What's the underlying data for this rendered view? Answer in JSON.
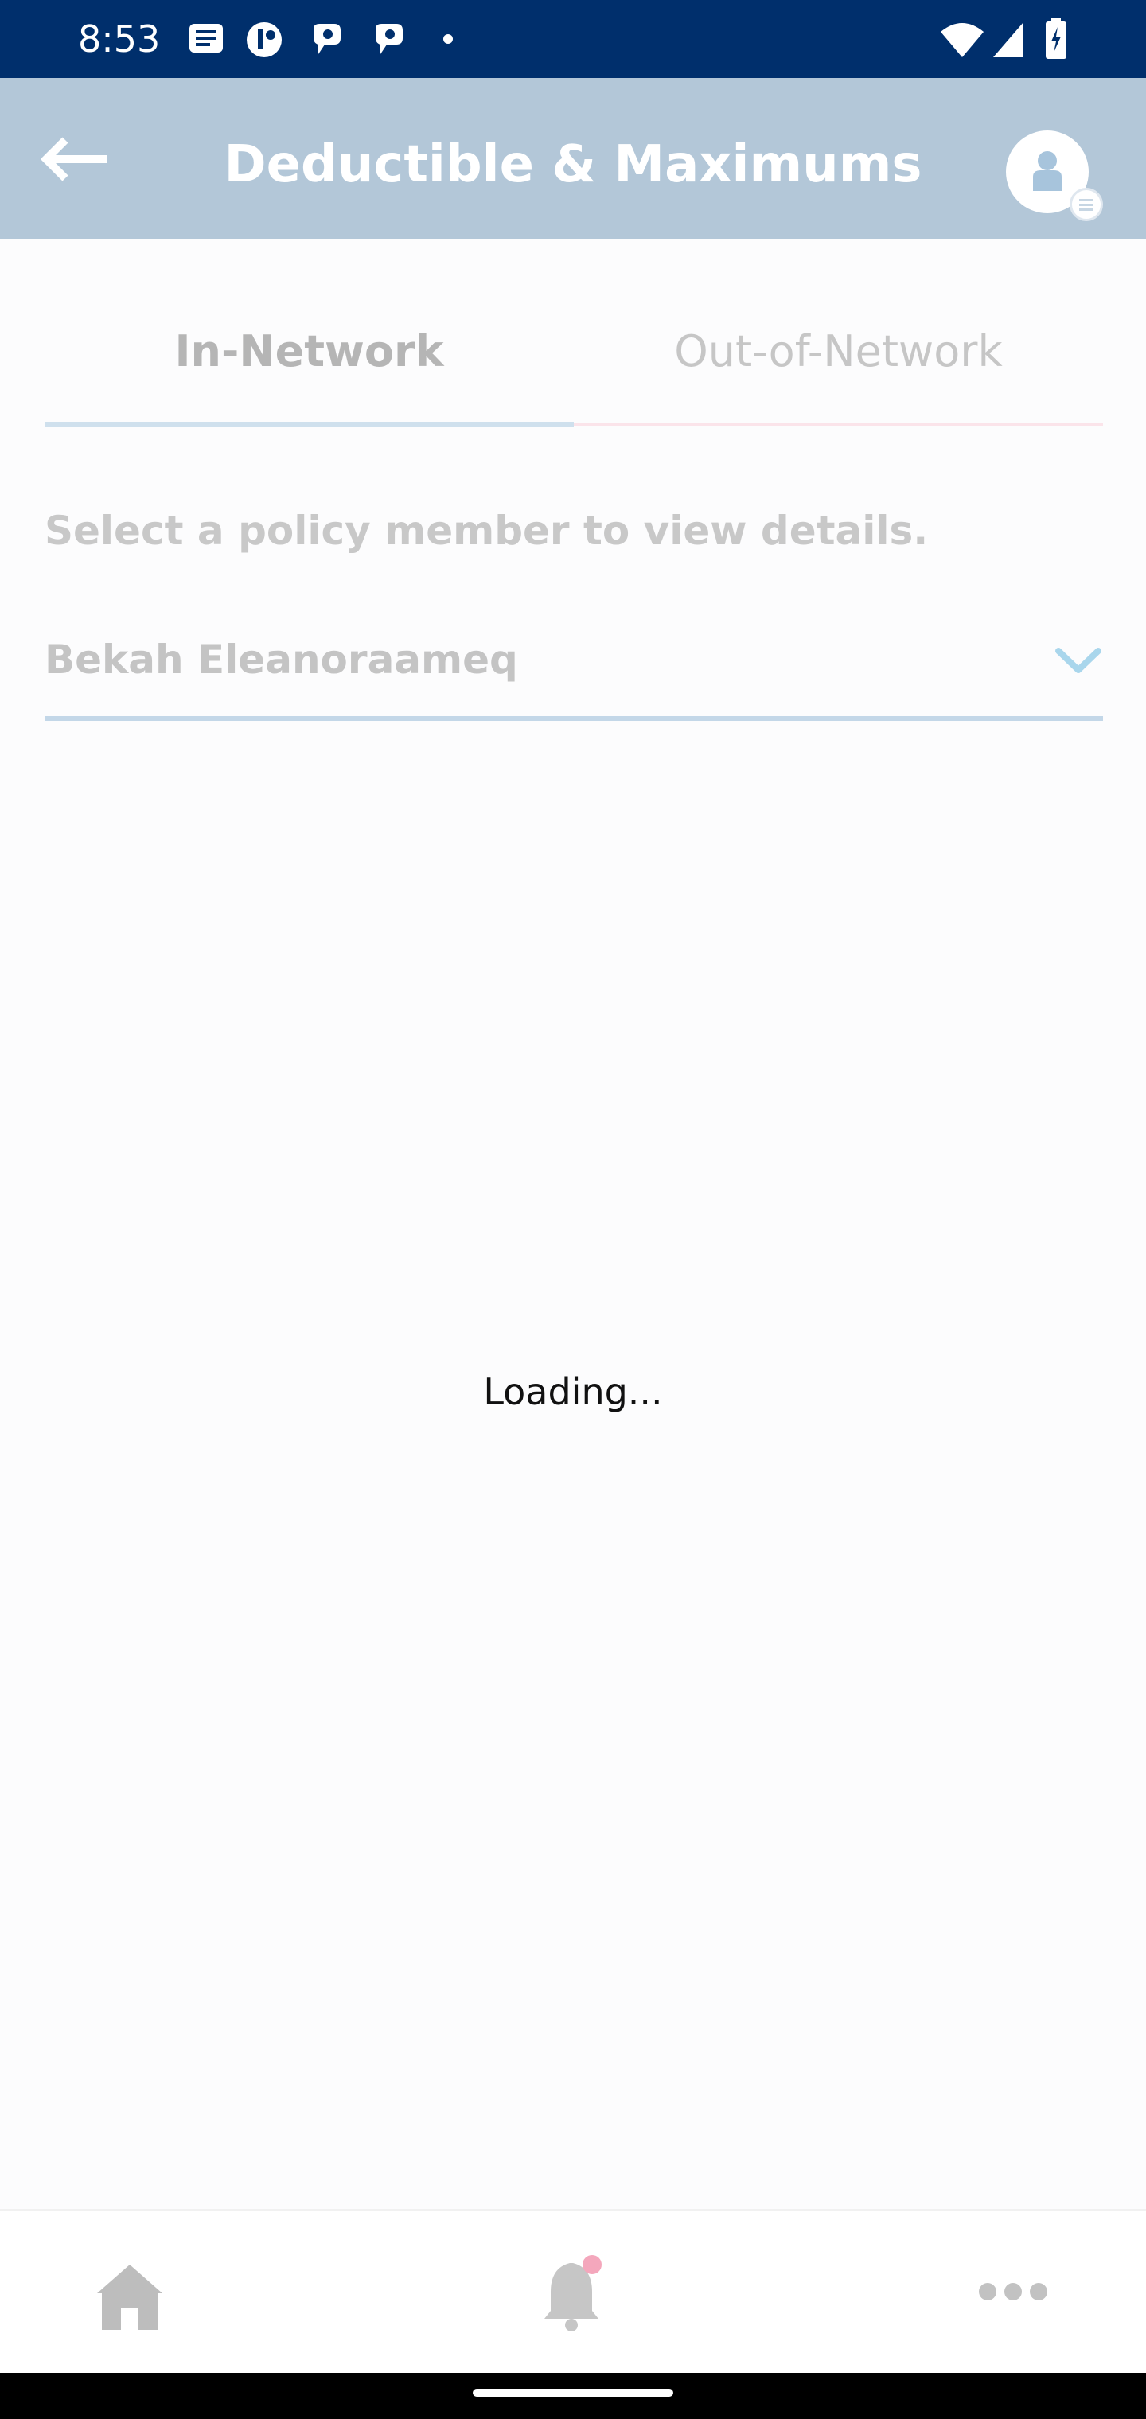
{
  "status_bar": {
    "time": "8:53",
    "left_icons": [
      "message-icon",
      "app-icon",
      "app-icon",
      "app-icon",
      "dot-icon"
    ],
    "right_icons": [
      "wifi-icon",
      "signal-icon",
      "battery-icon"
    ]
  },
  "header": {
    "title": "Deductible & Maximums",
    "back_icon": "arrow-left-icon",
    "profile_icon": "user-avatar-icon"
  },
  "tabs": [
    {
      "label": "In-Network",
      "active": true
    },
    {
      "label": "Out-of-Network",
      "active": false
    }
  ],
  "member": {
    "hint": "Select a policy member to view details.",
    "selected": "Bekah Eleanoraameq"
  },
  "content": {
    "loading_text": "Loading..."
  },
  "bottom_nav": {
    "items": [
      {
        "icon": "home-icon"
      },
      {
        "icon": "bell-icon",
        "badge": true
      },
      {
        "icon": "more-icon"
      }
    ]
  },
  "colors": {
    "status_bar": "#002f6c",
    "header": "#b3c7d8",
    "tab_active_line": "#cfe0ed",
    "tab_inactive_line": "#fbe4ea",
    "chevron": "#a9d6ec",
    "badge": "#f4a7bc"
  }
}
